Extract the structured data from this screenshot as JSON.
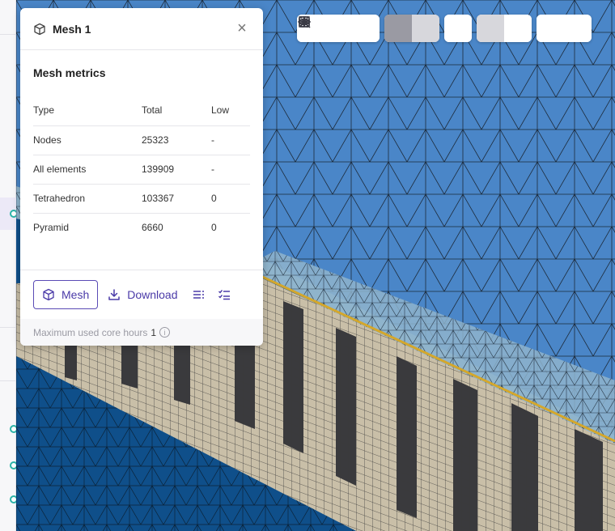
{
  "panel": {
    "title": "Mesh 1",
    "section_title": "Mesh metrics",
    "columns": [
      "Type",
      "Total",
      "Low"
    ],
    "rows": [
      {
        "type": "Nodes",
        "total": "25323",
        "low": "-"
      },
      {
        "type": "All elements",
        "total": "139909",
        "low": "-"
      },
      {
        "type": "Tetrahedron",
        "total": "103367",
        "low": "0"
      },
      {
        "type": "Pyramid",
        "total": "6660",
        "low": "0"
      }
    ],
    "mesh_button": "Mesh",
    "download_button": "Download",
    "core_hours_label": "Maximum used core hours",
    "core_hours_value": "1"
  },
  "toolbar": {
    "icons": [
      "zoom-fit-icon",
      "zoom-box-icon",
      "zoom-select-icon",
      "solid-view-icon",
      "wireframe-view-icon",
      "axes-icon",
      "section-view-icon",
      "grid-view-icon",
      "show-icon",
      "hide-icon"
    ]
  },
  "colors": {
    "accent": "#4a3aa8",
    "mesh_top": "#4a86c8",
    "mesh_light": "#8fb4cc",
    "mesh_beige": "#c9bfa8",
    "mesh_dark": "#3a3a3d",
    "mesh_front": "#0f4f8a",
    "mesh_edge": "#d4a72c"
  }
}
